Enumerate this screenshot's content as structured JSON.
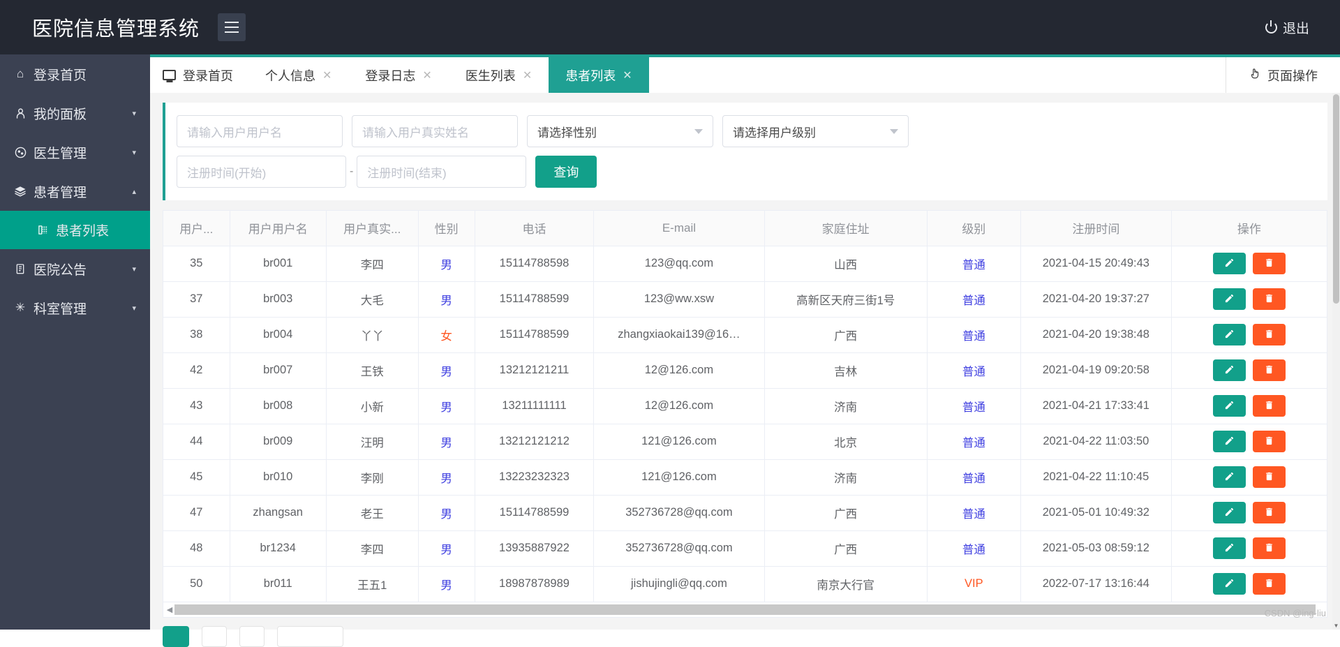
{
  "topbar": {
    "brand": "医院信息管理系统",
    "menu_toggle_icon": "hamburger-icon",
    "logout_label": "退出",
    "logout_icon": "power-icon"
  },
  "sidebar": {
    "items": [
      {
        "label": "登录首页",
        "icon": "home-icon",
        "glyph": "⌂",
        "caret": "",
        "active": false
      },
      {
        "label": "我的面板",
        "icon": "user-icon",
        "glyph": "🯅",
        "caret": "▾",
        "active": false
      },
      {
        "label": "医生管理",
        "icon": "doctor-icon",
        "glyph": "◕",
        "caret": "▾",
        "active": false
      },
      {
        "label": "患者管理",
        "icon": "layers-icon",
        "glyph": "◆",
        "caret": "▴",
        "active": false
      },
      {
        "label": "患者列表",
        "icon": "list-icon",
        "glyph": "▤",
        "caret": "",
        "active": true,
        "sub": true
      },
      {
        "label": "医院公告",
        "icon": "clipboard-icon",
        "glyph": "▣",
        "caret": "▾",
        "active": false
      },
      {
        "label": "科室管理",
        "icon": "asterisk-icon",
        "glyph": "✳",
        "caret": "▾",
        "active": false
      }
    ]
  },
  "tabs": {
    "items": [
      {
        "label": "登录首页",
        "closable": false,
        "active": false,
        "icon": "monitor-icon"
      },
      {
        "label": "个人信息",
        "closable": true,
        "active": false
      },
      {
        "label": "登录日志",
        "closable": true,
        "active": false
      },
      {
        "label": "医生列表",
        "closable": true,
        "active": false
      },
      {
        "label": "患者列表",
        "closable": true,
        "active": true
      }
    ],
    "close_glyph": "✕",
    "page_ops_label": "页面操作",
    "page_ops_icon": "hand-pointer-icon"
  },
  "search": {
    "username_placeholder": "请输入用户用户名",
    "realname_placeholder": "请输入用户真实姓名",
    "gender_select": "请选择性别",
    "level_select": "请选择用户级别",
    "date_start_placeholder": "注册时间(开始)",
    "date_separator": "-",
    "date_end_placeholder": "注册时间(结束)",
    "submit_label": "查询"
  },
  "table": {
    "columns": [
      "用户...",
      "用户用户名",
      "用户真实...",
      "性别",
      "电话",
      "E-mail",
      "家庭住址",
      "级别",
      "注册时间",
      "操作"
    ],
    "rows": [
      {
        "id": "35",
        "username": "br001",
        "realname": "李四",
        "gender": "男",
        "phone": "15114788598",
        "email": "123@qq.com",
        "address": "山西",
        "level": "普通",
        "regtime": "2021-04-15 20:49:43"
      },
      {
        "id": "37",
        "username": "br003",
        "realname": "大毛",
        "gender": "男",
        "phone": "15114788599",
        "email": "123@ww.xsw",
        "address": "高新区天府三街1号",
        "level": "普通",
        "regtime": "2021-04-20 19:37:27"
      },
      {
        "id": "38",
        "username": "br004",
        "realname": "丫丫",
        "gender": "女",
        "phone": "15114788599",
        "email": "zhangxiaokai139@16…",
        "address": "广西",
        "level": "普通",
        "regtime": "2021-04-20 19:38:48"
      },
      {
        "id": "42",
        "username": "br007",
        "realname": "王铁",
        "gender": "男",
        "phone": "13212121211",
        "email": "12@126.com",
        "address": "吉林",
        "level": "普通",
        "regtime": "2021-04-19 09:20:58"
      },
      {
        "id": "43",
        "username": "br008",
        "realname": "小新",
        "gender": "男",
        "phone": "13211111111",
        "email": "12@126.com",
        "address": "济南",
        "level": "普通",
        "regtime": "2021-04-21 17:33:41"
      },
      {
        "id": "44",
        "username": "br009",
        "realname": "汪明",
        "gender": "男",
        "phone": "13212121212",
        "email": "121@126.com",
        "address": "北京",
        "level": "普通",
        "regtime": "2021-04-22 11:03:50"
      },
      {
        "id": "45",
        "username": "br010",
        "realname": "李刚",
        "gender": "男",
        "phone": "13223232323",
        "email": "121@126.com",
        "address": "济南",
        "level": "普通",
        "regtime": "2021-04-22 11:10:45"
      },
      {
        "id": "47",
        "username": "zhangsan",
        "realname": "老王",
        "gender": "男",
        "phone": "15114788599",
        "email": "352736728@qq.com",
        "address": "广西",
        "level": "普通",
        "regtime": "2021-05-01 10:49:32"
      },
      {
        "id": "48",
        "username": "br1234",
        "realname": "李四",
        "gender": "男",
        "phone": "13935887922",
        "email": "352736728@qq.com",
        "address": "广西",
        "level": "普通",
        "regtime": "2021-05-03 08:59:12"
      },
      {
        "id": "50",
        "username": "br011",
        "realname": "王五1",
        "gender": "男",
        "phone": "18987878989",
        "email": "jishujingli@qq.com",
        "address": "南京大行官",
        "level": "VIP",
        "regtime": "2022-07-17 13:16:44"
      }
    ],
    "edit_icon": "pencil-icon",
    "delete_icon": "trash-icon"
  },
  "scrollbar": {
    "left_arrow": "◀",
    "right_arrow": "▶",
    "up_arrow": "▲",
    "down_arrow": "▼"
  },
  "watermark": "CSDN @ing-liu",
  "colors": {
    "brand_dark": "#242832",
    "sidebar": "#3b4152",
    "accent_teal": "#1fa093",
    "button_teal": "#12a08a",
    "danger_orange": "#ff5722",
    "link_blue": "#3f3fe0"
  }
}
